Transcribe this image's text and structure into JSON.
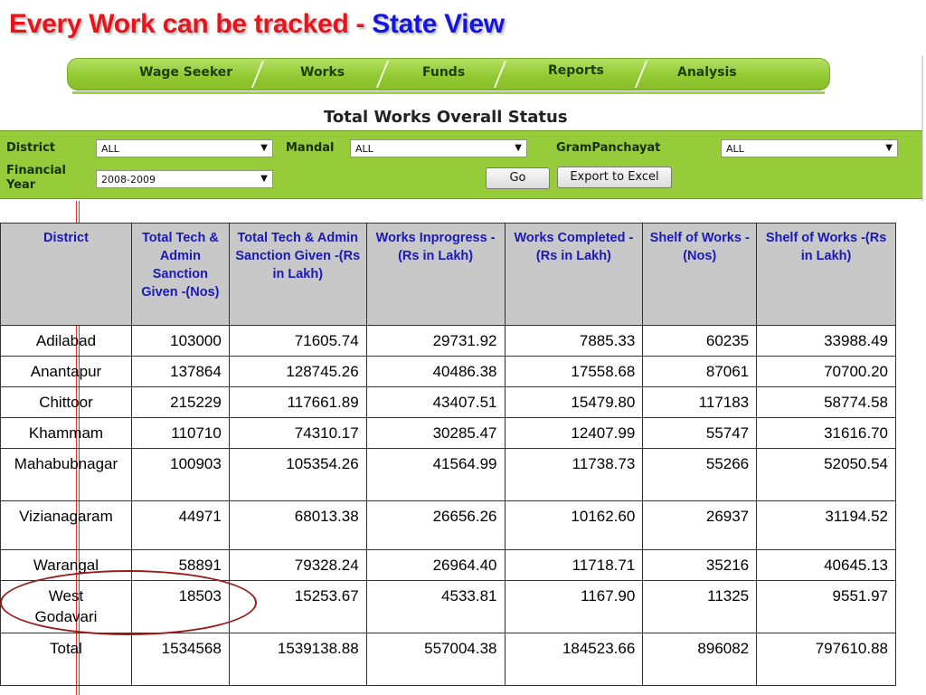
{
  "slide_title": {
    "part1": "Every Work can be tracked - ",
    "part2": "State View"
  },
  "nav": {
    "items": [
      "Wage Seeker",
      "Works",
      "Funds",
      "Reports",
      "Analysis"
    ]
  },
  "page_heading": "Total Works Overall Status",
  "filters": {
    "district_label": "District",
    "district_value": "ALL",
    "mandal_label": "Mandal",
    "mandal_value": "ALL",
    "grampanchayat_label": "GramPanchayat",
    "grampanchayat_value": "ALL",
    "financial_year_label_line1": "Financial",
    "financial_year_label_line2": "Year",
    "financial_year_value": "2008-2009",
    "go_button": "Go",
    "export_button": "Export to Excel"
  },
  "table": {
    "headers": [
      "District",
      "Total Tech & Admin Sanction Given -(Nos)",
      "Total Tech & Admin Sanction Given -(Rs in Lakh)",
      "Works Inprogress -(Rs in Lakh)",
      "Works Completed -(Rs in Lakh)",
      "Shelf of Works -(Nos)",
      "Shelf of Works -(Rs in Lakh)"
    ],
    "rows": [
      [
        "Adilabad",
        "103000",
        "71605.74",
        "29731.92",
        "7885.33",
        "60235",
        "33988.49"
      ],
      [
        "Anantapur",
        "137864",
        "128745.26",
        "40486.38",
        "17558.68",
        "87061",
        "70700.20"
      ],
      [
        "Chittoor",
        "215229",
        "117661.89",
        "43407.51",
        "15479.80",
        "117183",
        "58774.58"
      ],
      [
        "Khammam",
        "110710",
        "74310.17",
        "30285.47",
        "12407.99",
        "55747",
        "31616.70"
      ],
      [
        "Mahabubnagar",
        "100903",
        "105354.26",
        "41564.99",
        "11738.73",
        "55266",
        "52050.54"
      ],
      [
        "Vizianagaram",
        "44971",
        "68013.38",
        "26656.26",
        "10162.60",
        "26937",
        "31194.52"
      ],
      [
        "Warangal",
        "58891",
        "79328.24",
        "26964.40",
        "11718.71",
        "35216",
        "40645.13"
      ],
      [
        "West Godavari",
        "18503",
        "15253.67",
        "4533.81",
        "1167.90",
        "11325",
        "9551.97"
      ],
      [
        "Total",
        "1534568",
        "1539138.88",
        "557004.38",
        "184523.66",
        "896082",
        "797610.88"
      ]
    ]
  },
  "colors": {
    "title_red": "#e8141c",
    "title_blue": "#1515e0",
    "nav_green": "#93ca33",
    "filter_green": "#96cc3a",
    "header_blue": "#1a1ab8",
    "highlight_circle": "#9a1a1a"
  }
}
